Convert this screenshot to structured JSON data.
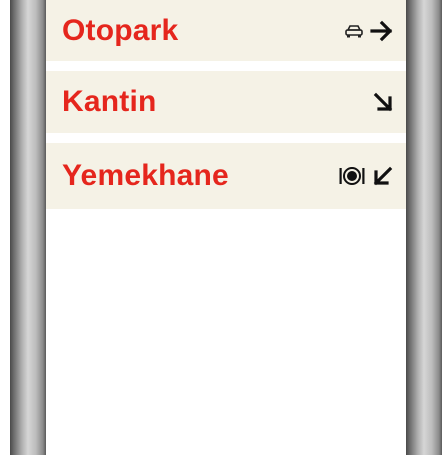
{
  "sign": {
    "rows": [
      {
        "label": "Otopark",
        "icon": "car-icon",
        "arrow": "arrow-right-icon"
      },
      {
        "label": "Kantin",
        "arrow": "arrow-down-right-icon"
      },
      {
        "label": "Yemekhane",
        "icon": "plate-cutlery-icon",
        "arrow": "arrow-down-left-icon"
      }
    ],
    "colors": {
      "text": "#e5261d",
      "panel": "#f5f2e6",
      "post": "#9a9a9a"
    }
  }
}
